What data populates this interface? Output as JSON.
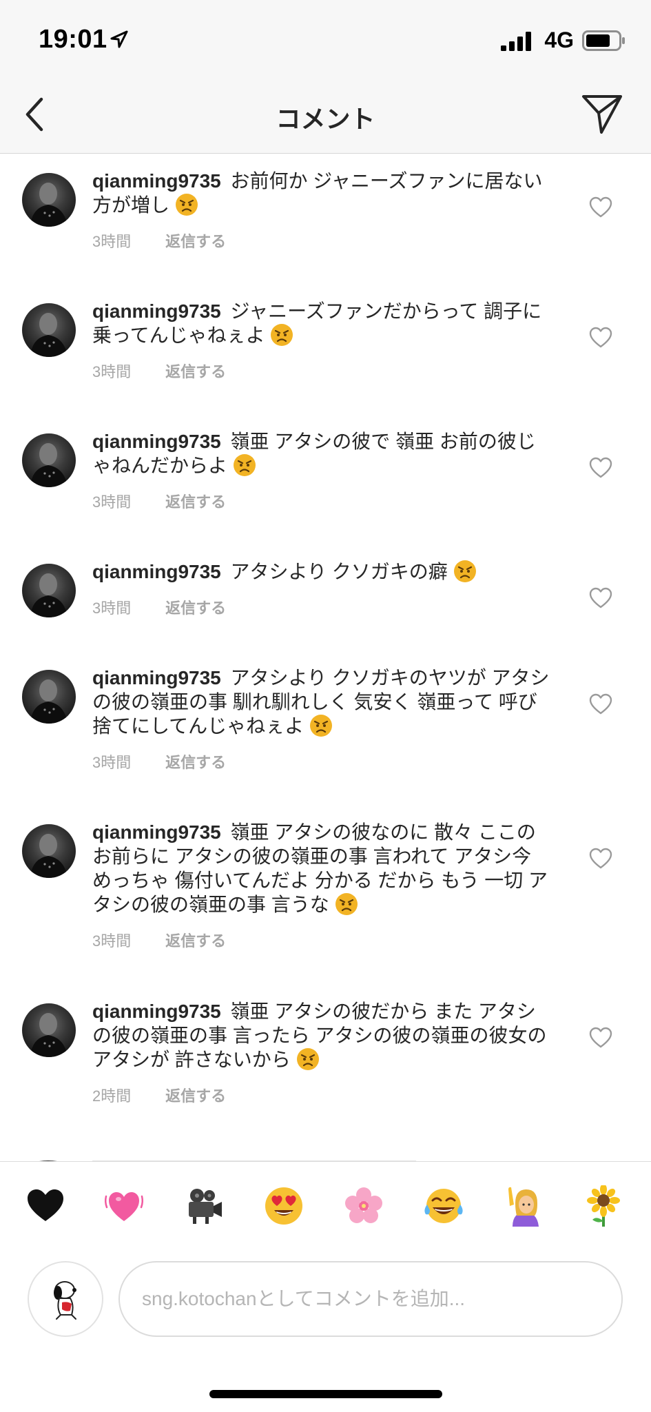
{
  "status_bar": {
    "time": "19:01",
    "network": "4G"
  },
  "header": {
    "title": "コメント"
  },
  "comments": [
    {
      "username": "qianming9735",
      "text": "お前何か ジャニーズファンに居ない方が増し",
      "time": "3時間",
      "reply": "返信する"
    },
    {
      "username": "qianming9735",
      "text": "ジャニーズファンだからって 調子に乗ってんじゃねぇよ",
      "time": "3時間",
      "reply": "返信する"
    },
    {
      "username": "qianming9735",
      "text": "嶺亜 アタシの彼で 嶺亜 お前の彼じゃねんだからよ",
      "time": "3時間",
      "reply": "返信する"
    },
    {
      "username": "qianming9735",
      "text": "アタシより クソガキの癖",
      "time": "3時間",
      "reply": "返信する"
    },
    {
      "username": "qianming9735",
      "text": "アタシより クソガキのヤツが アタシの彼の嶺亜の事 馴れ馴れしく 気安く 嶺亜って 呼び捨てにしてんじゃねぇよ",
      "time": "3時間",
      "reply": "返信する"
    },
    {
      "username": "qianming9735",
      "text": "嶺亜 アタシの彼なのに 散々 ここの お前らに アタシの彼の嶺亜の事 言われて アタシ今 めっちゃ 傷付いてんだよ 分かる だから もう 一切 アタシの彼の嶺亜の事 言うな",
      "time": "3時間",
      "reply": "返信する"
    },
    {
      "username": "qianming9735",
      "text": "嶺亜 アタシの彼だから また アタシの彼の嶺亜の事 言ったら アタシの彼の嶺亜の彼女の アタシが 許さないから",
      "time": "2時間",
      "reply": "返信する"
    }
  ],
  "quick_emojis": [
    "heart-black",
    "growing-heart",
    "movie-camera",
    "heart-eyes",
    "cherry-blossom",
    "tears-of-joy",
    "person-raising-hand",
    "sunflower"
  ],
  "composer": {
    "placeholder": "sng.kotochanとしてコメントを追加..."
  }
}
